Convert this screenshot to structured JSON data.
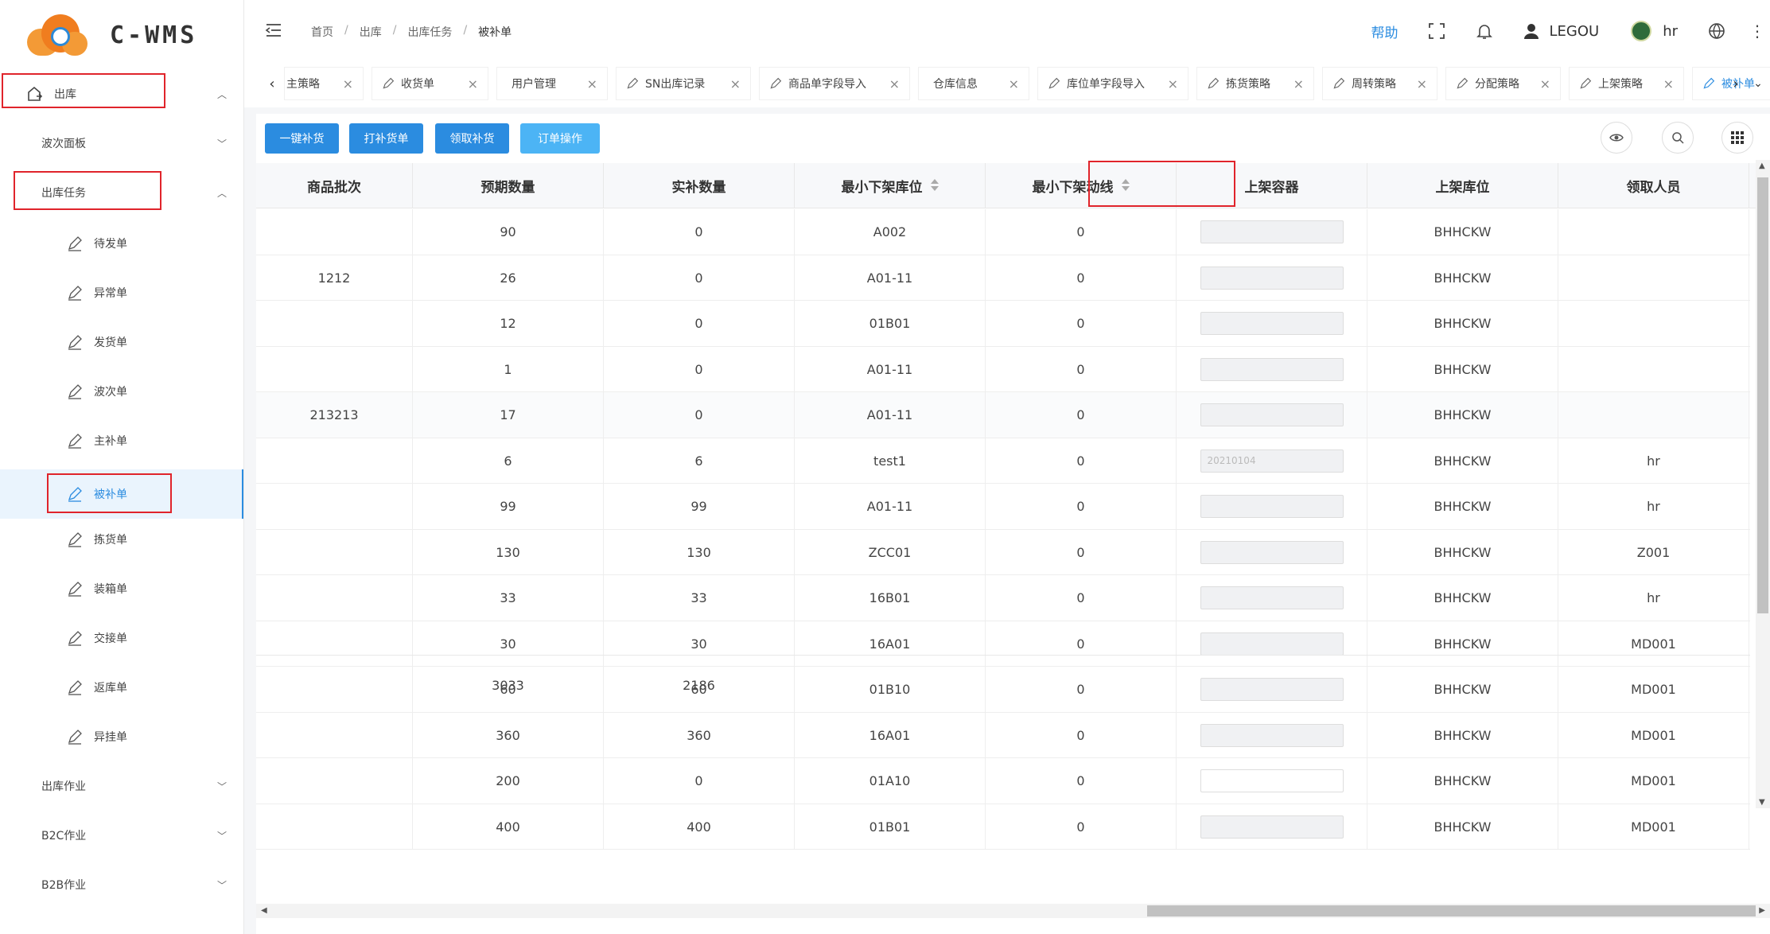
{
  "app": {
    "logo_text": "C-WMS"
  },
  "sidebar": {
    "outbound": "出库",
    "wave_panel": "波次面板",
    "outbound_task": "出库任务",
    "sub_items": [
      "待发单",
      "异常单",
      "发货单",
      "波次单",
      "主补单",
      "被补单",
      "拣货单",
      "装箱单",
      "交接单",
      "返库单",
      "异挂单"
    ],
    "active_item": "被补单",
    "outbound_ops": "出库作业",
    "b2c_ops": "B2C作业",
    "b2b_ops": "B2B作业"
  },
  "header": {
    "breadcrumb": [
      "首页",
      "出库",
      "出库任务",
      "被补单"
    ],
    "help": "帮助",
    "user": "LEGOU",
    "user2": "hr"
  },
  "tabs": [
    "主策略",
    "收货单",
    "用户管理",
    "SN出库记录",
    "商品单字段导入",
    "仓库信息",
    "库位单字段导入",
    "拣货策略",
    "周转策略",
    "分配策略",
    "上架策略",
    "被补单"
  ],
  "toolbar": {
    "btn1": "一键补货",
    "btn2": "打补货单",
    "btn3": "领取补货",
    "btn4": "订单操作"
  },
  "table": {
    "columns": [
      "商品批次",
      "预期数量",
      "实补数量",
      "最小下架库位",
      "最小下架动线",
      "上架容器",
      "上架库位",
      "领取人员"
    ],
    "rows": [
      [
        "",
        "90",
        "0",
        "A002",
        "0",
        "",
        "BHHCKW",
        ""
      ],
      [
        "1212",
        "26",
        "0",
        "A01-11",
        "0",
        "",
        "BHHCKW",
        ""
      ],
      [
        "",
        "12",
        "0",
        "01B01",
        "0",
        "",
        "BHHCKW",
        ""
      ],
      [
        "",
        "1",
        "0",
        "A01-11",
        "0",
        "",
        "BHHCKW",
        ""
      ],
      [
        "213213",
        "17",
        "0",
        "A01-11",
        "0",
        "",
        "BHHCKW",
        ""
      ],
      [
        "",
        "6",
        "6",
        "test1",
        "0",
        "20210104",
        "BHHCKW",
        "hr"
      ],
      [
        "",
        "99",
        "99",
        "A01-11",
        "0",
        "",
        "BHHCKW",
        "hr"
      ],
      [
        "",
        "130",
        "130",
        "ZCC01",
        "0",
        "",
        "BHHCKW",
        "Z001"
      ],
      [
        "",
        "33",
        "33",
        "16B01",
        "0",
        "",
        "BHHCKW",
        "hr"
      ],
      [
        "",
        "30",
        "30",
        "16A01",
        "0",
        "",
        "BHHCKW",
        "MD001"
      ],
      [
        "",
        "60",
        "60",
        "01B10",
        "0",
        "",
        "BHHCKW",
        "MD001"
      ],
      [
        "",
        "360",
        "360",
        "16A01",
        "0",
        "",
        "BHHCKW",
        "MD001"
      ],
      [
        "",
        "200",
        "0",
        "01A10",
        "0",
        "",
        "BHHCKW",
        "MD001"
      ],
      [
        "",
        "400",
        "400",
        "01B01",
        "0",
        "",
        "BHHCKW",
        "MD001"
      ]
    ],
    "summary": [
      "",
      "3033",
      "2186",
      "",
      "",
      "",
      "",
      ""
    ]
  }
}
